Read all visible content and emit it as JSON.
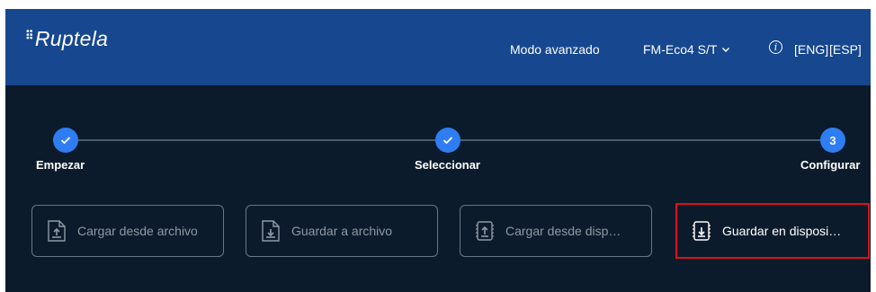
{
  "header": {
    "logo": "Ruptela",
    "advanced_mode": "Modo avanzado",
    "device_model": "FM-Eco4 S/T",
    "lang_eng": "[ENG]",
    "lang_esp": "[ESP]"
  },
  "steps": [
    {
      "label": "Empezar",
      "status": "done",
      "marker": "✓"
    },
    {
      "label": "Seleccionar",
      "status": "done",
      "marker": "✓"
    },
    {
      "label": "Configurar",
      "status": "current",
      "marker": "3"
    }
  ],
  "actions": [
    {
      "label": "Cargar desde archivo",
      "icon": "file-upload-icon",
      "highlighted": false
    },
    {
      "label": "Guardar a archivo",
      "icon": "file-download-icon",
      "highlighted": false
    },
    {
      "label": "Cargar desde disp…",
      "icon": "device-upload-icon",
      "highlighted": false
    },
    {
      "label": "Guardar en disposi…",
      "icon": "device-download-icon",
      "highlighted": true
    }
  ],
  "colors": {
    "header_bg": "#16478f",
    "body_bg": "#0c1b2b",
    "step_accent": "#2f7df2",
    "highlight": "#d8121b"
  }
}
